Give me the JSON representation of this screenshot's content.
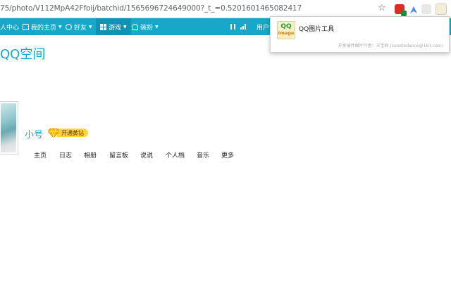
{
  "browser": {
    "url": "75/photo/V112MpA42Ffoij/batchid/1565696724649000?_t_=0.5201601465082417"
  },
  "navbar": {
    "personal_center": "人中心",
    "home": "我的主页",
    "friends": "好友",
    "games": "游戏",
    "dress_up": "装扮",
    "user_partial": "用户"
  },
  "popup": {
    "logo_top": "QQ",
    "logo_bottom": "Image",
    "title": "QQ图片工具",
    "credit": "开发插件图片作者：王宝群 (sunetedance@163.com)"
  },
  "page": {
    "title": "QQ空间",
    "username": "小号",
    "vip_label": "开通黄钻"
  },
  "subnav": {
    "items": [
      "主页",
      "日志",
      "相册",
      "留言板",
      "说说",
      "个人档",
      "音乐",
      "更多"
    ]
  },
  "colors": {
    "accent": "#17a7c9",
    "vip": "#ffd23b"
  }
}
